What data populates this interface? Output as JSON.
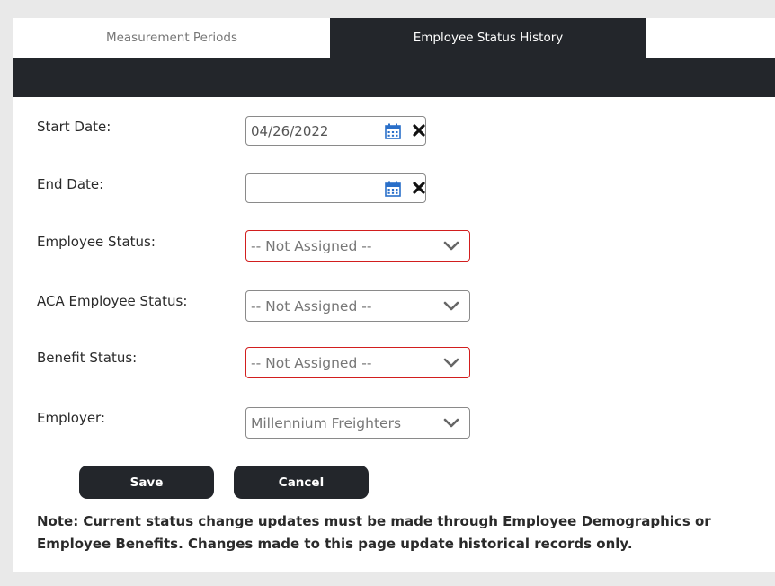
{
  "tabs": [
    {
      "label": "Measurement Periods",
      "active": false
    },
    {
      "label": "Employee Status History",
      "active": true
    }
  ],
  "form": {
    "start_date": {
      "label": "Start Date:",
      "value": "04/26/2022"
    },
    "end_date": {
      "label": "End Date:",
      "value": ""
    },
    "employee_status": {
      "label": "Employee Status:",
      "value": "-- Not Assigned --",
      "required": true
    },
    "aca_employee_status": {
      "label": "ACA Employee Status:",
      "value": "-- Not Assigned --",
      "required": false
    },
    "benefit_status": {
      "label": "Benefit Status:",
      "value": "-- Not Assigned --",
      "required": true
    },
    "employer": {
      "label": "Employer:",
      "value": "Millennium Freighters",
      "required": false
    }
  },
  "buttons": {
    "save": "Save",
    "cancel": "Cancel"
  },
  "note": "Note: Current status change updates must be made through Employee Demographics or Employee Benefits. Changes made to this page update historical records only.",
  "icons": {
    "calendar": "calendar-icon",
    "clear": "clear-icon",
    "dropdown": "chevron-down-icon"
  },
  "colors": {
    "dark": "#23262b",
    "required_border": "#d21e1e",
    "calendar_blue": "#2a6fc9"
  }
}
